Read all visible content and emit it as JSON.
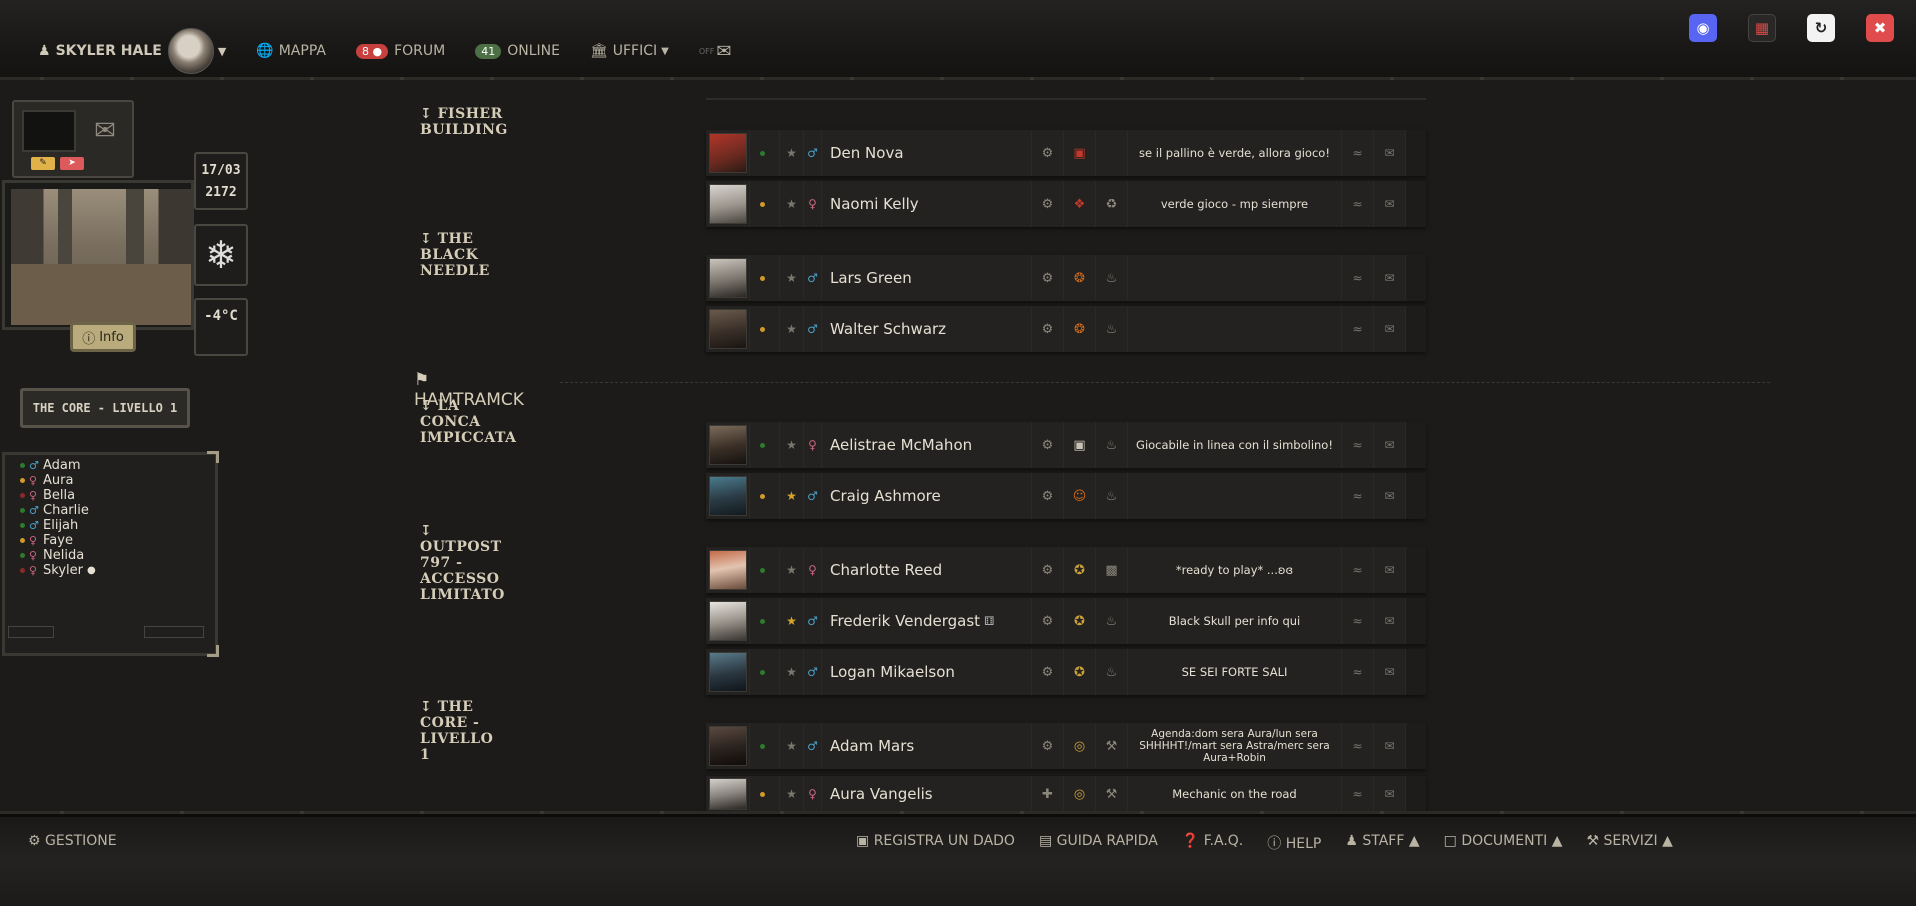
{
  "topbar": {
    "user": "SKYLER HALE",
    "nav": {
      "mappa": "MAPPA",
      "forum_count": "8",
      "forum": "FORUM",
      "online_count": "41",
      "online": "ONLINE",
      "uffici": "UFFICI",
      "off": "OFF"
    }
  },
  "left": {
    "date": "17/03",
    "year": "2172",
    "temp": "-4°C",
    "info": "Info",
    "location": "THE CORE - LIVELLO 1",
    "characters": [
      {
        "name": "Adam",
        "sex": "male",
        "status": "green"
      },
      {
        "name": "Aura",
        "sex": "female",
        "status": "orange"
      },
      {
        "name": "Bella",
        "sex": "female",
        "status": "red"
      },
      {
        "name": "Charlie",
        "sex": "male",
        "status": "green"
      },
      {
        "name": "Elijah",
        "sex": "male",
        "status": "green"
      },
      {
        "name": "Faye",
        "sex": "female",
        "status": "orange"
      },
      {
        "name": "Nelida",
        "sex": "female",
        "status": "green"
      },
      {
        "name": "Skyler",
        "sex": "female",
        "status": "red"
      }
    ]
  },
  "main": {
    "buildings": {
      "fisher": "FISHER BUILDING",
      "needle": "THE BLACK NEEDLE",
      "conca": "LA CONCA IMPICCATA",
      "outpost": "OUTPOST 797 - ACCESSO LIMITATO",
      "core": "THE CORE - LIVELLO 1"
    },
    "zone": "HAMTRAMCK",
    "rows": [
      {
        "name": "Den Nova",
        "status": "se il pallino è verde, allora gioco!"
      },
      {
        "name": "Naomi Kelly",
        "status": "verde gioco - mp siempre"
      },
      {
        "name": "Lars Green",
        "status": ""
      },
      {
        "name": "Walter Schwarz",
        "status": ""
      },
      {
        "name": "Aelistrae McMahon",
        "status": "Giocabile in linea con il simbolino!"
      },
      {
        "name": "Craig Ashmore",
        "status": ""
      },
      {
        "name": "Charlotte Reed",
        "status": "*ready to play* ...ʚɞ"
      },
      {
        "name": "Frederik Vendergast",
        "status": "Black Skull per info qui"
      },
      {
        "name": "Logan Mikaelson",
        "status": "SE SEI FORTE SALI"
      },
      {
        "name": "Adam Mars",
        "status": "Agenda:dom sera Aura/lun sera SHHHHT!/mart sera Astra/merc sera Aura+Robin"
      },
      {
        "name": "Aura Vangelis",
        "status": "Mechanic on the road"
      }
    ]
  },
  "bottombar": {
    "gestione": "GESTIONE",
    "links": {
      "dado": "REGISTRA UN DADO",
      "guida": "GUIDA RAPIDA",
      "faq": "F.A.Q.",
      "help": "HELP",
      "staff": "STAFF",
      "documenti": "DOCUMENTI",
      "servizi": "SERVIZI"
    }
  },
  "colors": {
    "online": "#2e7a2e",
    "away": "#d19a2a",
    "offline": "#8b2a2a",
    "discord": "#5865f2",
    "close": "#e04b4b"
  }
}
